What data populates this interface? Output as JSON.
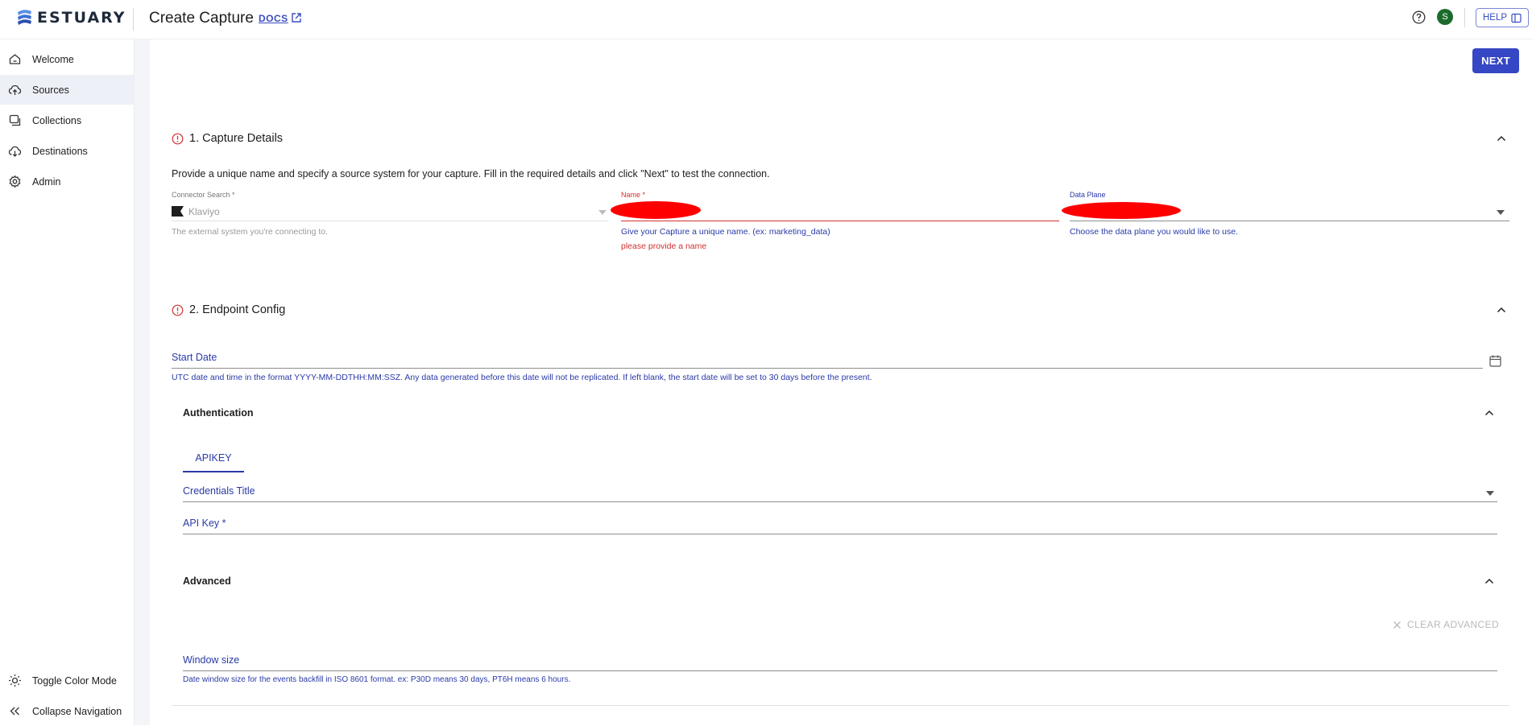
{
  "app": {
    "logo_text": "ESTUARY",
    "page_title": "Create Capture",
    "docs_label": "DOCS",
    "help_label": "HELP",
    "avatar_initial": "S"
  },
  "sidebar": {
    "items": [
      {
        "label": "Welcome",
        "icon": "home-icon"
      },
      {
        "label": "Sources",
        "icon": "cloud-upload-icon",
        "active": true
      },
      {
        "label": "Collections",
        "icon": "collections-icon"
      },
      {
        "label": "Destinations",
        "icon": "cloud-download-icon"
      },
      {
        "label": "Admin",
        "icon": "gear-icon"
      }
    ],
    "toggle_color_mode": "Toggle Color Mode",
    "collapse_navigation": "Collapse Navigation"
  },
  "toolbar": {
    "next_label": "NEXT"
  },
  "capture_details": {
    "title": "1. Capture Details",
    "description": "Provide a unique name and specify a source system for your capture. Fill in the required details and click \"Next\" to test the connection.",
    "connector": {
      "label": "Connector Search *",
      "value": "Klaviyo",
      "helper": "The external system you're connecting to."
    },
    "name": {
      "label": "Name *",
      "helper": "Give your Capture a unique name. (ex: marketing_data)",
      "error": "please provide a name"
    },
    "data_plane": {
      "label": "Data Plane",
      "helper": "Choose the data plane you would like to use."
    }
  },
  "endpoint_config": {
    "title": "2. Endpoint Config",
    "start_date": {
      "label": "Start Date",
      "helper": "UTC date and time in the format YYYY-MM-DDTHH:MM:SSZ. Any data generated before this date will not be replicated. If left blank, the start date will be set to 30 days before the present."
    },
    "authentication": {
      "title": "Authentication",
      "tab_label": "APIKEY",
      "credentials_title_label": "Credentials Title",
      "api_key_label": "API Key *"
    },
    "advanced": {
      "title": "Advanced",
      "clear_label": "CLEAR ADVANCED",
      "window_size": {
        "label": "Window size",
        "helper": "Date window size for the events backfill in ISO 8601 format. ex: P30D means 30 days, PT6H means 6 hours."
      }
    }
  },
  "colors": {
    "primary": "#3547c4",
    "link": "#2a3aa8",
    "error": "#d03030",
    "avatar": "#1d6b2c"
  }
}
